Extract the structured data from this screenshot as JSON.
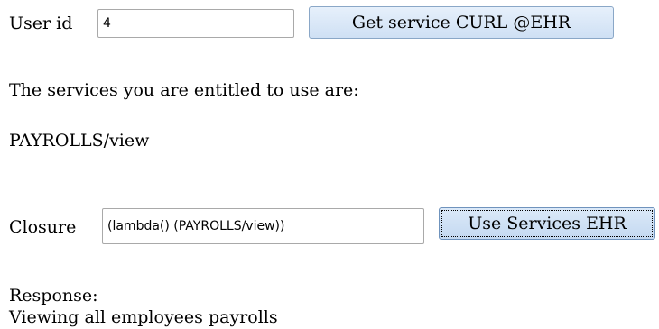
{
  "user_id": {
    "label": "User id",
    "value": "4"
  },
  "get_service_button": {
    "label": "Get service CURL @EHR"
  },
  "entitlement": {
    "intro": "The services you are entitled to use are:",
    "service": "PAYROLLS/view"
  },
  "closure": {
    "label": "Closure",
    "value": "(lambda() (PAYROLLS/view))"
  },
  "use_services_button": {
    "label": "Use Services EHR"
  },
  "response": {
    "label": "Response:",
    "text": "Viewing all employees payrolls"
  }
}
